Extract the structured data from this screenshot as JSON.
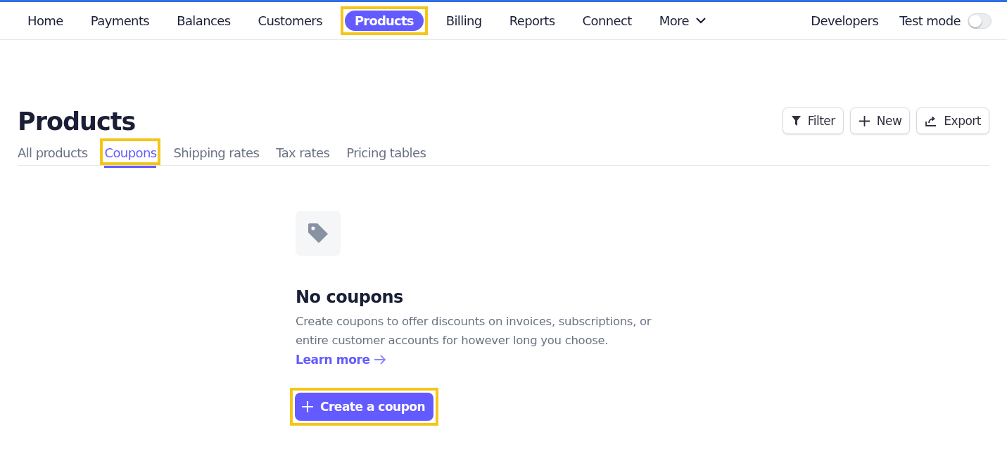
{
  "nav": {
    "items": [
      {
        "label": "Home",
        "selected": false,
        "highlighted": false
      },
      {
        "label": "Payments",
        "selected": false,
        "highlighted": false
      },
      {
        "label": "Balances",
        "selected": false,
        "highlighted": false
      },
      {
        "label": "Customers",
        "selected": false,
        "highlighted": false
      },
      {
        "label": "Products",
        "selected": true,
        "highlighted": true
      },
      {
        "label": "Billing",
        "selected": false,
        "highlighted": false
      },
      {
        "label": "Reports",
        "selected": false,
        "highlighted": false
      },
      {
        "label": "Connect",
        "selected": false,
        "highlighted": false
      },
      {
        "label": "More",
        "selected": false,
        "highlighted": false,
        "kind": "dropdown"
      }
    ],
    "developers": "Developers",
    "test_mode": {
      "label": "Test mode",
      "on": false
    }
  },
  "page": {
    "title": "Products",
    "actions": [
      {
        "label": "Filter",
        "kind": "filter"
      },
      {
        "label": "New",
        "kind": "add"
      },
      {
        "label": "Export",
        "kind": "export"
      }
    ],
    "tabs": [
      {
        "label": "All products",
        "selected": false,
        "highlighted": false
      },
      {
        "label": "Coupons",
        "selected": true,
        "highlighted": true
      },
      {
        "label": "Shipping rates",
        "selected": false,
        "highlighted": false
      },
      {
        "label": "Tax rates",
        "selected": false,
        "highlighted": false
      },
      {
        "label": "Pricing tables",
        "selected": false,
        "highlighted": false
      }
    ]
  },
  "empty_state": {
    "title": "No coupons",
    "description": "Create coupons to offer discounts on invoices, subscriptions, or entire customer accounts for however long you choose.",
    "link": "Learn more",
    "button": {
      "label": "Create a coupon",
      "highlighted": true
    }
  }
}
